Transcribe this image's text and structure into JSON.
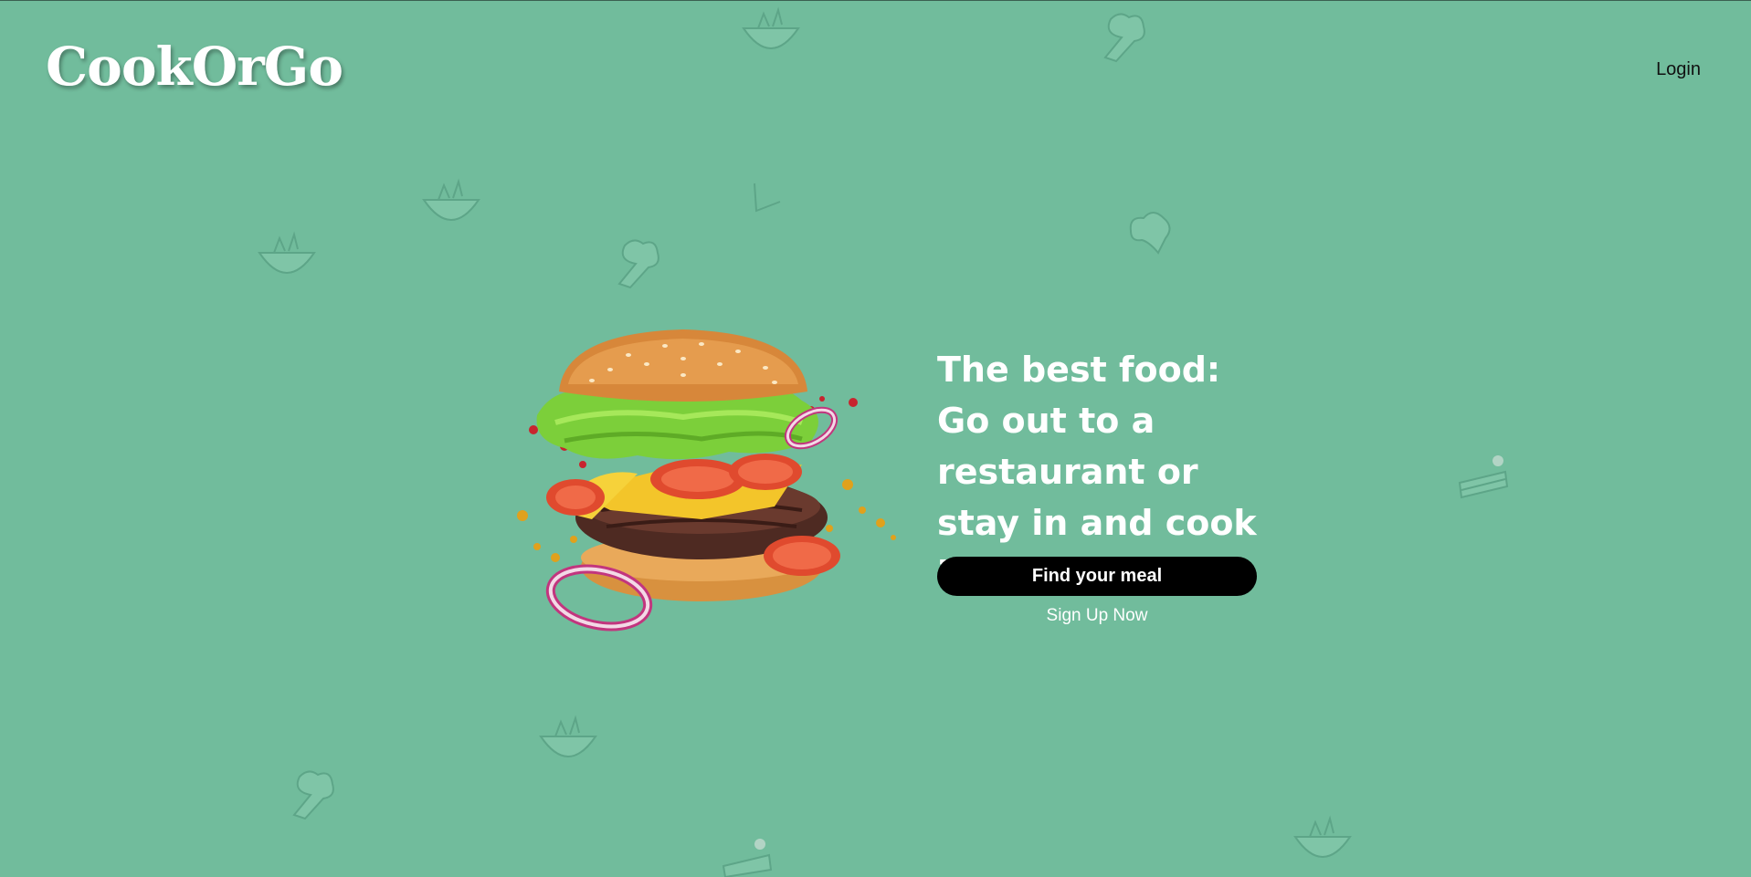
{
  "header": {
    "logo": "CookOrGo",
    "login_label": "Login"
  },
  "hero": {
    "image_icon": "burger-image",
    "headline": "The best food: Go out to a restaurant or stay in and cook it yourself.",
    "cta_label": "Find your meal",
    "signup_label": "Sign Up Now"
  },
  "colors": {
    "background": "#71bc9c",
    "button": "#000000",
    "text_light": "#ffffff"
  }
}
